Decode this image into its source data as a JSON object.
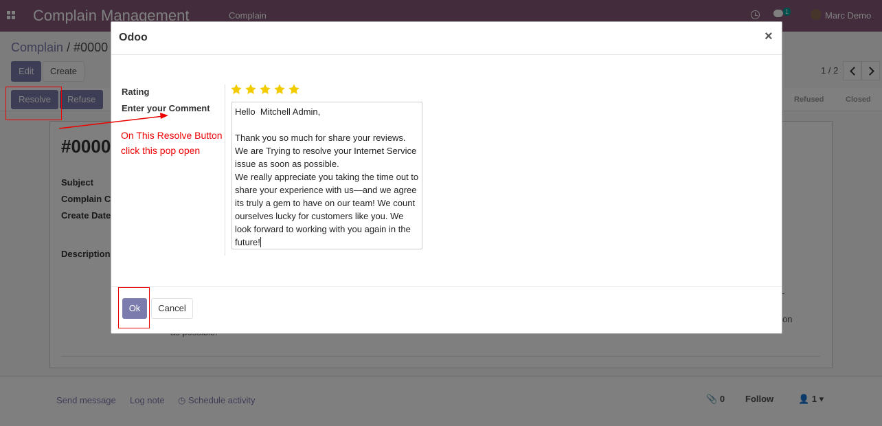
{
  "navbar": {
    "app_title": "Complain Management",
    "menu_item": "Complain",
    "chat_badge": "1",
    "user_name": "Marc Demo"
  },
  "breadcrumb": {
    "parent": "Complain",
    "separator": "/",
    "current": "#0000"
  },
  "toolbar": {
    "edit_label": "Edit",
    "create_label": "Create"
  },
  "pager": {
    "value": "1 / 2"
  },
  "status_buttons": {
    "resolve_label": "Resolve",
    "refuse_label": "Refuse"
  },
  "stages": [
    "Refused",
    "Closed"
  ],
  "record": {
    "title": "#0000",
    "fields": [
      "Subject",
      "Complain C",
      "Create Date",
      "Description"
    ],
    "desc_fragment_1": "-",
    "desc_fragment_2": "on",
    "desc_fragment_3": "as possible."
  },
  "chatter": {
    "send_message": "Send message",
    "log_note": "Log note",
    "schedule_activity": "Schedule activity",
    "attachments_count": "0",
    "follow_label": "Follow",
    "followers_count": "1"
  },
  "dialog": {
    "title": "Odoo",
    "close_glyph": "×",
    "rating_label": "Rating",
    "rating_value": 5,
    "rating_max": 5,
    "comment_label": "Enter your Comment",
    "comment_value": "Hello  Mitchell Admin,\n\nThank you so much for share your reviews.\nWe are Trying to resolve your Internet Service issue as soon as possible.\nWe really appreciate you taking the time out to share your experience with us—and we agree its truly a gem to have on our team! We count ourselves lucky for customers like you. We look forward to working with you again in the future!",
    "ok_label": "Ok",
    "cancel_label": "Cancel"
  },
  "annotation": {
    "line1": "On This Resolve Button",
    "line2": "click this pop open"
  },
  "colors": {
    "brand": "#875a7b",
    "primary_button": "#7c7bad",
    "star": "#f3cc00",
    "annotation": "#e00000"
  }
}
